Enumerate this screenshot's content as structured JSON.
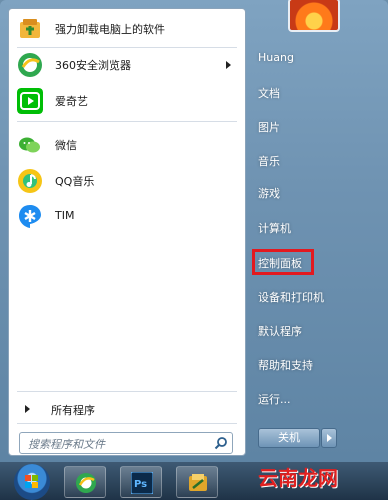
{
  "left_panel": {
    "programs": [
      {
        "label": "强力卸载电脑上的软件",
        "icon": "uninstall-tool-icon"
      },
      {
        "label": "360安全浏览器",
        "icon": "360-browser-icon",
        "has_submenu": true
      },
      {
        "label": "爱奇艺",
        "icon": "iqiyi-icon"
      },
      {
        "label": "微信",
        "icon": "wechat-icon"
      },
      {
        "label": "QQ音乐",
        "icon": "qq-music-icon"
      },
      {
        "label": "TIM",
        "icon": "tim-icon"
      }
    ],
    "all_programs": "所有程序",
    "search_placeholder": "搜索程序和文件"
  },
  "right_panel": {
    "items": [
      {
        "label": "Huang"
      },
      {
        "label": "文档"
      },
      {
        "label": "图片"
      },
      {
        "label": "音乐"
      },
      {
        "label": "游戏"
      },
      {
        "label": "计算机"
      },
      {
        "label": "控制面板",
        "highlighted": true
      },
      {
        "label": "设备和打印机"
      },
      {
        "label": "默认程序"
      },
      {
        "label": "帮助和支持"
      },
      {
        "label": "运行..."
      }
    ],
    "shutdown_label": "关机"
  },
  "taskbar": {
    "apps": [
      "360-browser-icon",
      "photoshop-icon",
      "file-manager-icon"
    ],
    "photoshop_text": "Ps"
  },
  "watermark": "云南龙网",
  "colors": {
    "highlight_border": "#e3191f",
    "panel_bg": "#ffffff",
    "frame_bg": "#6f93b2"
  }
}
